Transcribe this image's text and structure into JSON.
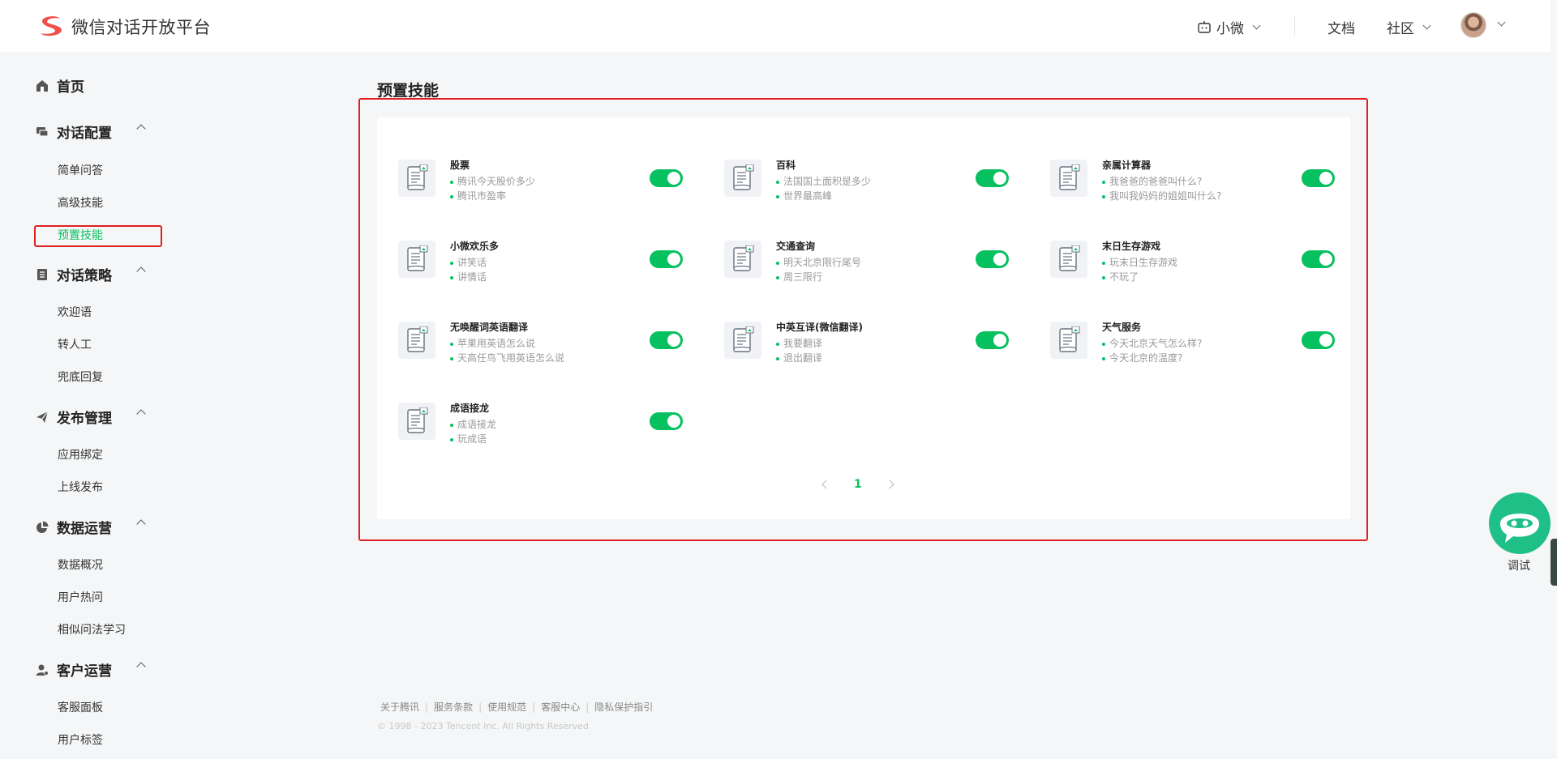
{
  "header": {
    "brand": "微信对话开放平台",
    "bot_name": "小微",
    "docs": "文档",
    "community": "社区"
  },
  "sidebar": {
    "sections": [
      {
        "label": "首页",
        "icon": "home-icon",
        "items": []
      },
      {
        "label": "对话配置",
        "icon": "chat-config-icon",
        "items": [
          "简单问答",
          "高级技能",
          "预置技能"
        ]
      },
      {
        "label": "对话策略",
        "icon": "strategy-icon",
        "items": [
          "欢迎语",
          "转人工",
          "兜底回复"
        ]
      },
      {
        "label": "发布管理",
        "icon": "publish-icon",
        "items": [
          "应用绑定",
          "上线发布"
        ]
      },
      {
        "label": "数据运营",
        "icon": "pie-chart-icon",
        "items": [
          "数据概况",
          "用户热问",
          "相似问法学习"
        ]
      },
      {
        "label": "客户运营",
        "icon": "customer-icon",
        "items": [
          "客服面板",
          "用户标签"
        ]
      }
    ],
    "active_item": "预置技能"
  },
  "main": {
    "title": "预置技能",
    "skills": [
      {
        "name": "股票",
        "examples": [
          "腾讯今天股价多少",
          "腾讯市盈率"
        ],
        "enabled": true
      },
      {
        "name": "百科",
        "examples": [
          "法国国土面积是多少",
          "世界最高峰"
        ],
        "enabled": true
      },
      {
        "name": "亲属计算器",
        "examples": [
          "我爸爸的爸爸叫什么?",
          "我叫我妈妈的姐姐叫什么?"
        ],
        "enabled": true
      },
      {
        "name": "小微欢乐多",
        "examples": [
          "讲笑话",
          "讲情话"
        ],
        "enabled": true
      },
      {
        "name": "交通查询",
        "examples": [
          "明天北京限行尾号",
          "周三限行"
        ],
        "enabled": true
      },
      {
        "name": "末日生存游戏",
        "examples": [
          "玩末日生存游戏",
          "不玩了"
        ],
        "enabled": true
      },
      {
        "name": "无唤醒词英语翻译",
        "examples": [
          "苹果用英语怎么说",
          "天高任鸟飞用英语怎么说"
        ],
        "enabled": true
      },
      {
        "name": "中英互译(微信翻译)",
        "examples": [
          "我要翻译",
          "退出翻译"
        ],
        "enabled": true
      },
      {
        "name": "天气服务",
        "examples": [
          "今天北京天气怎么样?",
          "今天北京的温度?"
        ],
        "enabled": true
      },
      {
        "name": "成语接龙",
        "examples": [
          "成语接龙",
          "玩成语"
        ],
        "enabled": true
      }
    ],
    "pagination": {
      "current": "1"
    }
  },
  "footer": {
    "links": [
      "关于腾讯",
      "服务条款",
      "使用规范",
      "客服中心",
      "隐私保护指引"
    ],
    "copyright": "© 1998 - 2023 Tencent Inc. All Rights Reserved"
  },
  "debug": {
    "label": "调试"
  },
  "colors": {
    "accent": "#07c160",
    "highlight_box": "#e02020",
    "debug_button": "#1fc087"
  }
}
